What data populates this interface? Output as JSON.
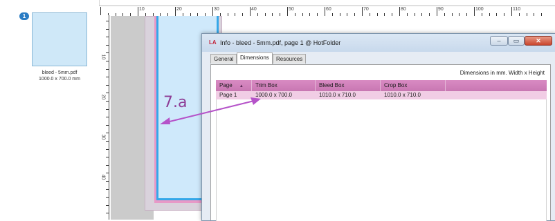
{
  "thumbnails": {
    "badge": "1",
    "caption_line1": "bleed - 5mm.pdf",
    "caption_line2": "1000.0 x 700.0 mm"
  },
  "ruler": {
    "top_labels": [
      "10",
      "20",
      "30",
      "40",
      "50",
      "60",
      "70",
      "80",
      "90",
      "100",
      "110"
    ],
    "left_labels": [
      "10",
      "20",
      "30",
      "40"
    ]
  },
  "dialog": {
    "app_icon": "LA",
    "title": "Info - bleed - 5mm.pdf, page 1 @ HotFolder",
    "buttons": {
      "minimize": "–",
      "maximize": "▭",
      "close": "✕"
    },
    "tabs": [
      {
        "label": "General",
        "active": false
      },
      {
        "label": "Dimensions",
        "active": true
      },
      {
        "label": "Resources",
        "active": false
      }
    ],
    "dims_note": "Dimensions in mm. Width x Height",
    "columns": [
      "Page",
      "Trim Box",
      "Bleed Box",
      "Crop Box"
    ],
    "sort_indicator": "▲",
    "rows": [
      {
        "page": "Page 1",
        "trim": "1000.0 x 700.0",
        "bleed": "1010.0 x 710.0",
        "crop": "1010.0 x 710.0"
      }
    ]
  },
  "annotation": {
    "label": "7.a",
    "color": "#8e3d96"
  },
  "colors": {
    "page_blue": "#35a8e9",
    "bleed_pink": "#e799c7",
    "table_header": "#c877b2"
  }
}
